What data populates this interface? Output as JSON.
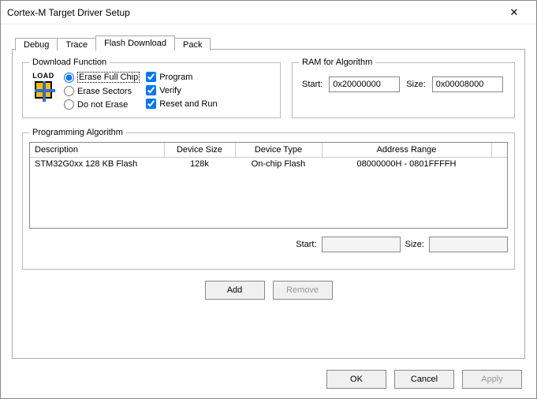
{
  "window": {
    "title": "Cortex-M Target Driver Setup",
    "close": "✕"
  },
  "tabs": [
    "Debug",
    "Trace",
    "Flash Download",
    "Pack"
  ],
  "activeTab": 2,
  "downloadFunction": {
    "legend": "Download Function",
    "loadLabel": "LOAD",
    "radios": [
      {
        "label": "Erase Full Chip",
        "checked": true
      },
      {
        "label": "Erase Sectors",
        "checked": false
      },
      {
        "label": "Do not Erase",
        "checked": false
      }
    ],
    "checks": [
      {
        "label": "Program",
        "checked": true
      },
      {
        "label": "Verify",
        "checked": true
      },
      {
        "label": "Reset and Run",
        "checked": true
      }
    ]
  },
  "ram": {
    "legend": "RAM for Algorithm",
    "startLabel": "Start:",
    "startValue": "0x20000000",
    "sizeLabel": "Size:",
    "sizeValue": "0x00008000"
  },
  "progAlg": {
    "legend": "Programming Algorithm",
    "headers": [
      "Description",
      "Device Size",
      "Device Type",
      "Address Range"
    ],
    "rows": [
      {
        "desc": "STM32G0xx 128 KB Flash",
        "size": "128k",
        "type": "On-chip Flash",
        "range": "08000000H - 0801FFFFH"
      }
    ],
    "startLabel": "Start:",
    "startValue": "",
    "sizeLabel": "Size:",
    "sizeValue": "",
    "addLabel": "Add",
    "removeLabel": "Remove"
  },
  "footer": {
    "ok": "OK",
    "cancel": "Cancel",
    "apply": "Apply"
  }
}
